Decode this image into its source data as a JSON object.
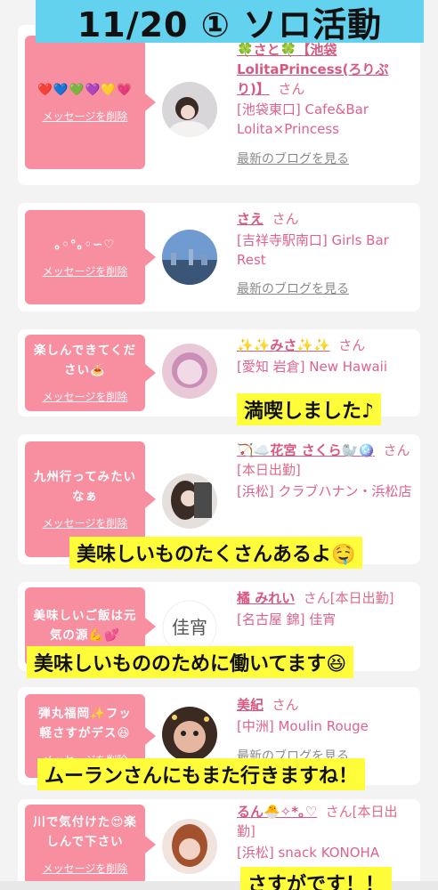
{
  "header_title": "11/20 ① ソロ活動",
  "delete_label": "メッセージを削除",
  "blog_label": "最新のブログを見る",
  "cards": [
    {
      "message": "❤️💙💚💜💛💗",
      "name": "🍀さと🍀【池袋LolitaPrincess(ろりぷり)】",
      "san": "さん",
      "shop": "[池袋東口] Cafe&Bar Lolita×Princess"
    },
    {
      "message": "｡◦°｡◦∽♡",
      "name": "さえ",
      "san": "さん",
      "shop": "[吉祥寺駅南口] Girls Bar Rest"
    },
    {
      "message": "楽しんできてください🍝",
      "name": "✨✨みさ✨✨",
      "san": "さん",
      "shop": "[愛知 岩倉] New Hawaii"
    },
    {
      "message": "九州行ってみたいなぁ",
      "name": "🏹☁️花宮 さくら🦭🪩",
      "san": "さん[本日出勤]",
      "shop": "[浜松] クラブハナン・浜松店"
    },
    {
      "message": "美味しいご飯は元気の源💪💕",
      "name": "橘 みれい",
      "san": "さん[本日出勤]",
      "shop": "[名古屋 錦] 佳宵"
    },
    {
      "message": "弾丸福岡✨フッ軽さすがデス😆",
      "name": "美紀",
      "san": "さん",
      "shop": "[中洲] Moulin Rouge"
    },
    {
      "message": "川で気付けた😍楽しんで下さい",
      "name": "るん🐣✧*｡♡",
      "san": "さん[本日出勤]",
      "shop": "[浜松] snack KONOHA"
    }
  ],
  "captions": {
    "c1": "満喫しました♪",
    "c2": "美味しいものたくさんあるよ🤤",
    "c3": "美味しいもののために働いてます😆",
    "c4": "ムーランさんにもまた行きますね！",
    "c5": "さすがです！！"
  },
  "colors": {
    "title_bar": "#62d2ee",
    "bubble": "#f88fa1",
    "name": "#d9587f",
    "caption_bg": "#fffc3a"
  }
}
